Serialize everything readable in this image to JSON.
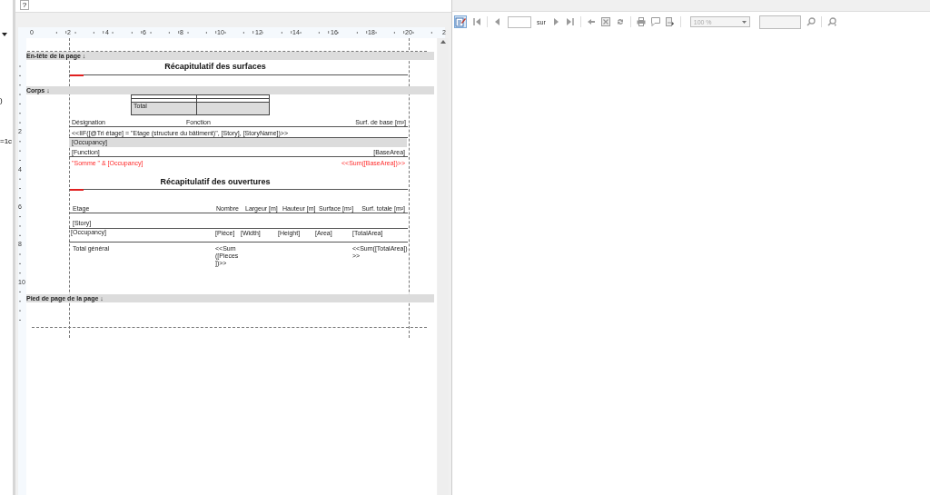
{
  "help_button": "?",
  "left_panel": {
    "texts": [
      ")",
      "=1c"
    ]
  },
  "ruler": {
    "horizontal": [
      "0",
      "2",
      "4",
      "6",
      "8",
      "10",
      "12",
      "14",
      "16",
      "18",
      "20",
      "2"
    ],
    "vertical": [
      "2",
      "4",
      "6",
      "8",
      "10"
    ]
  },
  "report": {
    "items": [
      {
        "kind": "band",
        "text": "En-tête de la page ↓"
      },
      {
        "kind": "title",
        "text": "Récapitulatif des surfaces"
      },
      {
        "kind": "band",
        "text": "Corps ↓"
      },
      {
        "kind": "text",
        "text": "Total"
      },
      {
        "kind": "text",
        "text": "Désignation"
      },
      {
        "kind": "text",
        "text": "Fonction"
      },
      {
        "kind": "text",
        "text": "Surf. de base [m²]"
      },
      {
        "kind": "text",
        "text": "<<IIF([@Tri étage] = \"Etage (structure du bâtiment)\", [Story], [StoryName])>>"
      },
      {
        "kind": "text",
        "text": "[Occupancy]"
      },
      {
        "kind": "text",
        "text": "[Function]"
      },
      {
        "kind": "text",
        "text": "[BaseArea]"
      },
      {
        "kind": "formula",
        "text": "\"Somme \" & [Occupancy]"
      },
      {
        "kind": "formula",
        "text": "<<Sum([BaseArea])>>"
      },
      {
        "kind": "title",
        "text": "Récapitulatif des ouvertures"
      },
      {
        "kind": "text",
        "text": "Etage"
      },
      {
        "kind": "text",
        "text": "Nombre"
      },
      {
        "kind": "text",
        "text": "Largeur [m]"
      },
      {
        "kind": "text",
        "text": "Hauteur [m]"
      },
      {
        "kind": "text",
        "text": "Surface [m²]"
      },
      {
        "kind": "text",
        "text": "Surf. totale [m²]"
      },
      {
        "kind": "text",
        "text": "[Story]"
      },
      {
        "kind": "text",
        "text": "[Occupancy]"
      },
      {
        "kind": "text",
        "text": "[Pièce]"
      },
      {
        "kind": "text",
        "text": "[Width]"
      },
      {
        "kind": "text",
        "text": "[Height]"
      },
      {
        "kind": "text",
        "text": "[Area]"
      },
      {
        "kind": "text",
        "text": "[TotalArea]"
      },
      {
        "kind": "text",
        "text": "Total général"
      },
      {
        "kind": "text",
        "text": "<<Sum ([Pieces ])>>"
      },
      {
        "kind": "text",
        "text": "<<Sum([TotalArea]) >>"
      },
      {
        "kind": "band",
        "text": "Pied de page de la page ↓"
      }
    ]
  },
  "viewer_toolbar": {
    "edit_selected": true,
    "page_label": "sur",
    "zoom": "100 %"
  }
}
